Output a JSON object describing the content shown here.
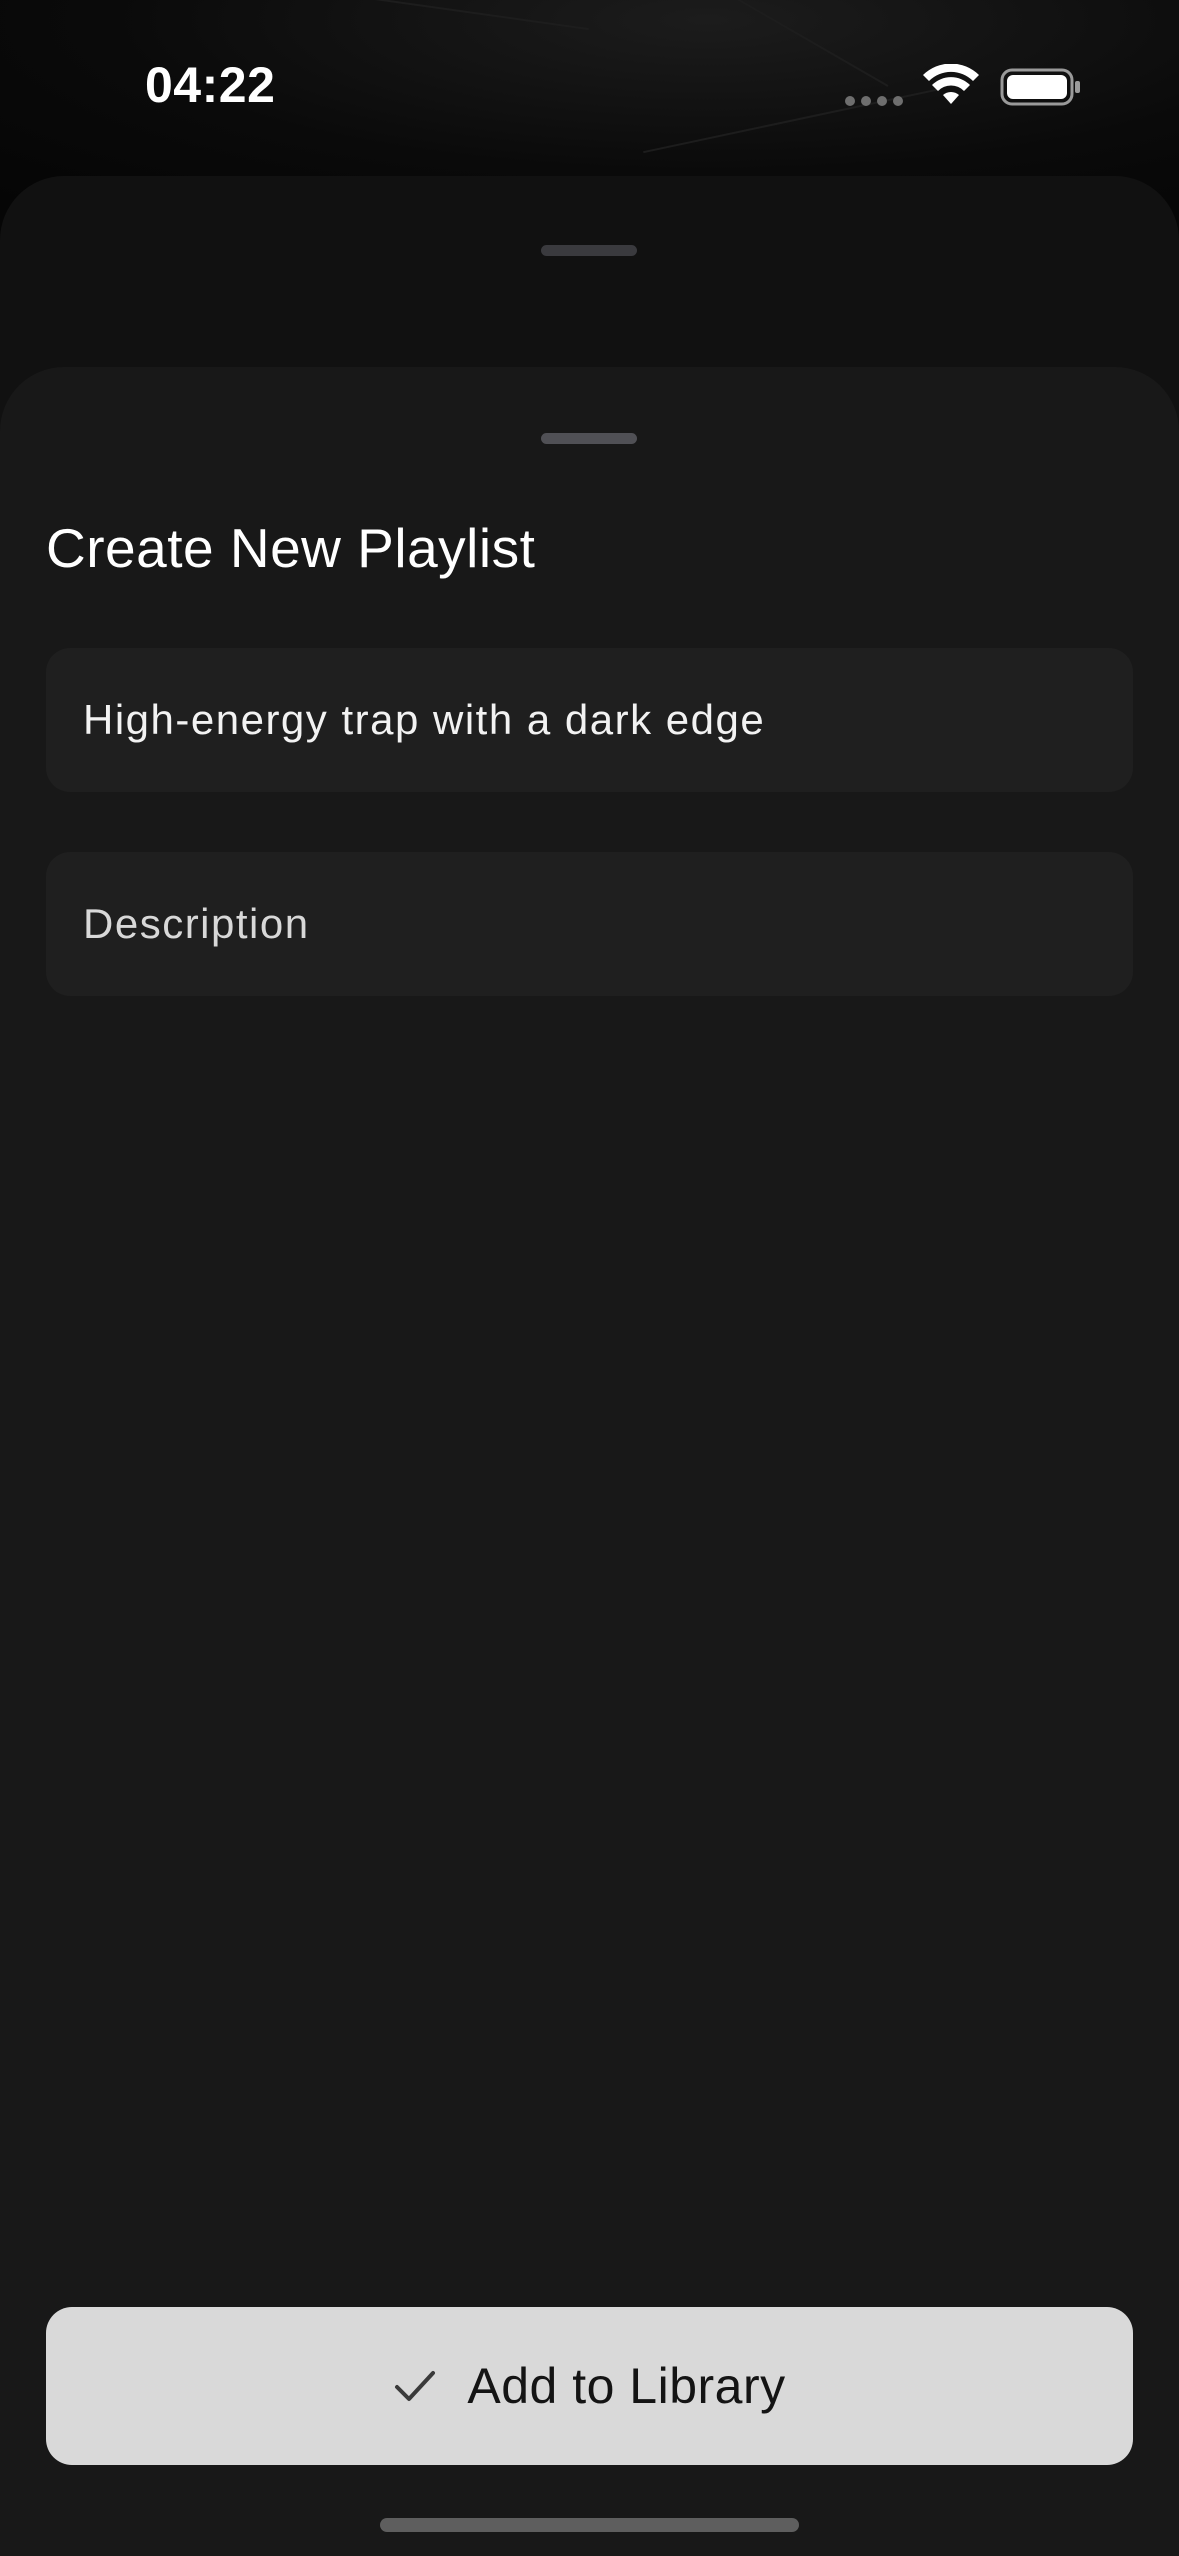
{
  "status_bar": {
    "time": "04:22",
    "icons": [
      "cellular-dots-icon",
      "wifi-icon",
      "battery-icon"
    ]
  },
  "sheet": {
    "title": "Create New Playlist",
    "name_field": {
      "value": "High-energy trap with a dark edge"
    },
    "description_field": {
      "placeholder": "Description"
    },
    "add_button": {
      "icon": "checkmark-icon",
      "label": "Add to Library"
    }
  },
  "colors": {
    "sheet_background": "#181818",
    "field_background": "#1f1f1f",
    "button_background": "#d9d9d9",
    "text_primary": "#ffffff"
  }
}
